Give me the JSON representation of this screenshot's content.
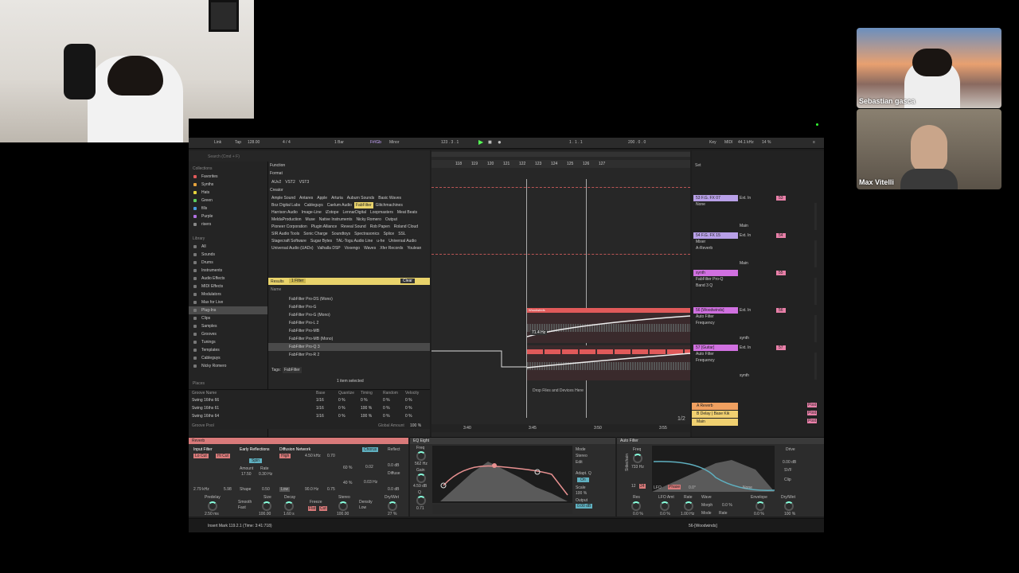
{
  "participants": [
    {
      "name": "Sebastian gasca"
    },
    {
      "name": "Max Vitelli"
    }
  ],
  "transport": {
    "link": "Link",
    "tap": "Tap",
    "tempo": "128.00",
    "sig": "4 / 4",
    "loop": "1 Bar",
    "key": "F#/Gb",
    "scale": "Minor",
    "pos1": "123 . 3 . 1",
    "pos2": "1 . 1 . 1",
    "len": "200 . 0 . 0",
    "key_label": "Key",
    "midi": "MIDI",
    "sr": "44.1 kHz",
    "cpu": "14 %"
  },
  "browser": {
    "search": "Search (Cmd + F)",
    "collections_hdr": "Collections",
    "collections": [
      {
        "label": "Favorites",
        "color": "#e05a5a"
      },
      {
        "label": "Synths",
        "color": "#e6a33c"
      },
      {
        "label": "Hats",
        "color": "#e6d23c"
      },
      {
        "label": "Green",
        "color": "#5fcf5f"
      },
      {
        "label": "fills",
        "color": "#4a9be0"
      },
      {
        "label": "Purple",
        "color": "#b070e0"
      },
      {
        "label": "risers",
        "color": "#888888"
      }
    ],
    "library_hdr": "Library",
    "library": [
      "All",
      "Sounds",
      "Drums",
      "Instruments",
      "Audio Effects",
      "MIDI Effects",
      "Modulators",
      "Max for Live",
      "Plug-Ins",
      "Clips",
      "Samples",
      "Grooves",
      "Tunings",
      "Templates",
      "Cableguys",
      "Nicky Romero"
    ],
    "places_hdr": "Places",
    "function": "Function",
    "format": "Format",
    "formats": [
      "AUv2",
      "VST2",
      "VST3"
    ],
    "creator": "Creator",
    "creators": [
      "Ample Sound",
      "Antares",
      "Apple",
      "Arturia",
      "Auburn Sounds",
      "Basic Waves",
      "Boz Digital Labs",
      "Cableguys",
      "Caelum Audio",
      "FabFilter",
      "Glitchmachines",
      "Harrison Audio",
      "Image-Line",
      "iZotope",
      "LennarDigital",
      "Loopmasters",
      "Meat Beats",
      "MeldaProduction",
      "Muse",
      "Native Instruments",
      "Nicky Romero",
      "Output",
      "Pioneer Corporation",
      "Plugin Alliance",
      "Reveal Sound",
      "Rob Papen",
      "Roland Cloud",
      "SIR Audio Tools",
      "Sonic Charge",
      "Soundtoys",
      "Spectrasonics",
      "Splice",
      "SSL",
      "Stagecraft Software",
      "Sugar Bytes",
      "TAL-Togu Audio Line",
      "u-he",
      "Universal Audio",
      "Universal Audio (UADx)",
      "Valhalla DSP",
      "Voxengo",
      "Waves",
      "Xfer Records",
      "Youlean"
    ],
    "results_label": "Results",
    "filter_count": "1 Filter",
    "clear": "Clear",
    "name_hdr": "Name",
    "results": [
      "FabFilter Pro-DS (Mono)",
      "FabFilter Pro-G",
      "FabFilter Pro-G (Mono)",
      "FabFilter Pro-L 2",
      "FabFilter Pro-MB",
      "FabFilter Pro-MB (Mono)",
      "FabFilter Pro-Q 3",
      "FabFilter Pro-R 2"
    ],
    "tags": "Tags:",
    "tag_val": "FabFilter",
    "selected": "1 item selected"
  },
  "groove": {
    "headers": [
      "Groove Name",
      "Base",
      "Quantize",
      "Timing",
      "Random",
      "Velocity"
    ],
    "rows": [
      [
        "Swing 16ths 66",
        "1/16",
        "0 %",
        "0 %",
        "0 %",
        "0 %"
      ],
      [
        "Swing 16ths 61",
        "1/16",
        "0 %",
        "100 %",
        "0 %",
        "0 %"
      ],
      [
        "Swing 16ths 64",
        "1/16",
        "0 %",
        "100 %",
        "0 %",
        "0 %"
      ]
    ],
    "pool": "Groove Pool",
    "global": "Global Amount",
    "global_val": "100 %"
  },
  "arrangement": {
    "ruler": [
      "118",
      "119",
      "120",
      "121",
      "122",
      "123",
      "124",
      "125",
      "126",
      "127"
    ],
    "drop": "Drop Files and Devices Here",
    "freq": "71.4 Hz",
    "times": [
      "3:40",
      "3:45",
      "3:50",
      "3:55"
    ],
    "zoom": "1/2",
    "clip": "Woodwinds",
    "clip2": "Guitar"
  },
  "mixer": {
    "set": "Set",
    "tracks": [
      {
        "name": "53 F.G. FX 07",
        "color": "#b8a0e8",
        "dev1": "None",
        "io": "Ext. In",
        "out": "Main",
        "num": "53"
      },
      {
        "name": "54 F.G. FX 15",
        "color": "#b8a0e8",
        "dev1": "Mixer",
        "dev2": "A-Reverb",
        "io": "Ext. In",
        "out": "Main",
        "num": "54"
      },
      {
        "name": "synth",
        "color": "#d070e0",
        "dev1": "FabFilter Pro-Q",
        "dev2": "Band 3 Q",
        "num": "55"
      },
      {
        "name": "56 [Woodwinds]",
        "color": "#d070e0",
        "dev1": "Auto Filter",
        "dev2": "Frequency",
        "io": "Ext. In",
        "out": "synth",
        "num": "56"
      },
      {
        "name": "57 [Guitar]",
        "color": "#d070e0",
        "dev1": "Auto Filter",
        "dev2": "Frequency",
        "io": "Ext. In",
        "out": "synth",
        "num": "57"
      }
    ],
    "returns": [
      {
        "name": "A Reverb",
        "color": "#f0a060"
      },
      {
        "name": "B Delay | Base Kik",
        "color": "#f0d070"
      },
      {
        "name": "Main",
        "color": "#f0d070"
      }
    ],
    "post": "Post"
  },
  "devices": {
    "reverb": {
      "title": "Reverb",
      "input": "Input Filter",
      "lowcut": "Lo Cut",
      "hicut": "Hi Cut",
      "f1": "2.79 kHz",
      "f2": "5.98",
      "early": "Early Reflections",
      "spin": "Spin",
      "amount": "Amount",
      "rate": "Rate",
      "a1": "17.50",
      "r1": "0.30 Hz",
      "shape": "Shape",
      "s1": "0.50",
      "diff": "Diffusion Network",
      "high": "High",
      "hf": "4.50 kHz",
      "hv": "0.70",
      "low": "Low",
      "lf": "90.0 Hz",
      "lv": "0.75",
      "chorus": "Chorus",
      "camt": "0.02",
      "crate": "0.03 Hz",
      "reflect": "Reflect",
      "rv": "0.0 dB",
      "diffuse": "Diffuse",
      "dv": "0.0 dB",
      "predelay": "Predelay",
      "pv": "2.50 ms",
      "smooth": "Smooth",
      "sm": "Fast",
      "size": "Size",
      "szv": "100.00",
      "decay": "Decay",
      "dcv": "1.60 s",
      "freeze": "Freeze",
      "flat": "Flat",
      "cut": "Cut",
      "stereo": "Stereo",
      "stv": "100.00",
      "density": "Density",
      "dens": "Low",
      "drywet": "Dry/Wet",
      "dw": "27 %",
      "dpct": "60 %",
      "spct": "40 %"
    },
    "eq": {
      "title": "EQ Eight",
      "freq": "Freq",
      "fv": "562 Hz",
      "gain": "Gain",
      "gv": "4.59 dB",
      "q": "Q",
      "qv": "0.71",
      "mode": "Mode",
      "stereo": "Stereo",
      "edit": "Edit",
      "adapt": "Adapt. Q",
      "on": "On",
      "scale": "Scale",
      "scv": "100 %",
      "output": "Output",
      "ov": "0.00 dB"
    },
    "autofilter": {
      "title": "Auto Filter",
      "freq": "Freq",
      "fv": "733 Hz",
      "res": "Res",
      "resv": "0.0 %",
      "lfo": "LFO",
      "lfoamt": "LFO Amt",
      "lv": "0.0 %",
      "rate": "Rate",
      "rv": "1.00 Hz",
      "wave": "Wave",
      "phase": "Phase",
      "deg": "0.0°",
      "morph": "Morph",
      "mv": "0.0 %",
      "mode": "Mode",
      "mode_v": "Rate",
      "env": "Envelope",
      "ev": "0.0 %",
      "drive": "Drive",
      "drv": "0.00 dB",
      "svf": "SVF",
      "clip": "Clip",
      "drywet": "Dry/Wet",
      "dw": "100 %",
      "none": "None",
      "r12": "12",
      "r24": "24",
      "sidechain": "Sidechain"
    }
  },
  "status": {
    "text": "Insert Mark 119.2.1 (Time: 3:41:718)",
    "track": "56-[Woodwinds]"
  }
}
